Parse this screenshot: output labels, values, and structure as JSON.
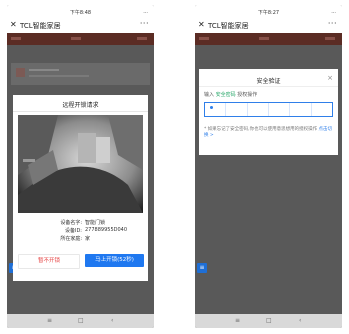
{
  "left": {
    "status": {
      "time": "下午8:48",
      "right": "..."
    },
    "title": {
      "close_glyph": "✕",
      "app_title": "TCL智能家居",
      "more": "···"
    },
    "dialog": {
      "title": "远程开锁请求",
      "rows": [
        {
          "key": "设备名字:",
          "value": "智能门锁"
        },
        {
          "key": "设备ID:",
          "value": "277889955D040"
        },
        {
          "key": "所在家庭:",
          "value": "家"
        }
      ],
      "reject_label": "暂不开锁",
      "accept_label": "马上开锁(52秒)"
    },
    "nav": {
      "recent": "≡",
      "home": "□",
      "back": "‹"
    }
  },
  "right": {
    "status": {
      "time": "下午8:27",
      "right": "..."
    },
    "title": {
      "close_glyph": "✕",
      "app_title": "TCL智能家居",
      "more": "···"
    },
    "sheet": {
      "title": "安全验证",
      "close_glyph": "×",
      "prompt_before": "输入",
      "prompt_highlight": "安全密码",
      "prompt_after": "授权操作",
      "note_text": "* 如果忘记了安全密码,你也可以使用意思想用的授权操作",
      "note_link": "点击切换 >"
    },
    "nav": {
      "recent": "≡",
      "home": "□",
      "back": "‹"
    }
  },
  "icons": {
    "float_button": "list-icon",
    "close": "close-icon",
    "more": "more-icon"
  },
  "colors": {
    "accent_blue": "#1f78f0",
    "reject_red": "#e64242",
    "success_green": "#2aa86b",
    "overlay_gray": "#595959"
  }
}
